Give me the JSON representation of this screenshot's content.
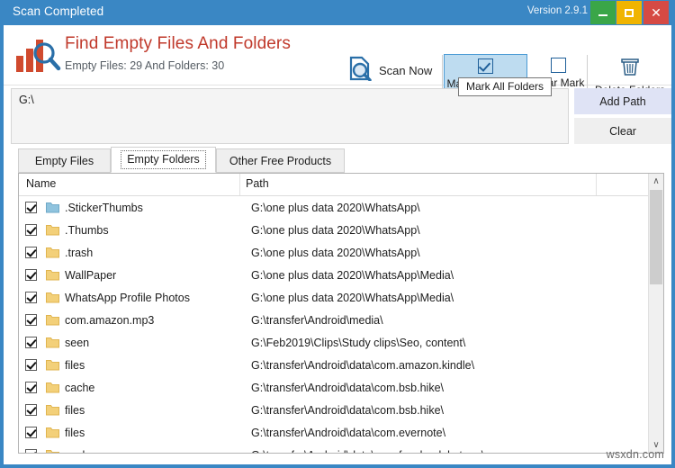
{
  "window": {
    "title": "Scan Completed",
    "version": "Version 2.9.1",
    "minimize_label": "Minimize",
    "maximize_label": "Maximize",
    "close_label": "Close",
    "frame_color": "#3a87c4"
  },
  "header": {
    "app_title": "Find Empty Files And Folders",
    "subtitle": "Empty Files: 29 And Folders: 30",
    "title_color": "#c0392b",
    "logo_bar_color": "#d04a2e",
    "logo_lens_color": "#2a6fa8"
  },
  "toolbar": {
    "scan_label": "Scan Now",
    "mark_all_label": "Mark All Folders",
    "clear_mark_label": "Clear Mark",
    "delete_label": "Delete Folders",
    "active_button_bg": "#bedcf0",
    "active_button_border": "#4a9ad4"
  },
  "tooltip": {
    "text": "Mark All Folders"
  },
  "path_panel": {
    "value": "G:\\",
    "placeholder": "",
    "add_path_label": "Add Path",
    "clear_label": "Clear",
    "add_path_bg": "#dfe3f5"
  },
  "tabs": [
    {
      "label": "Empty Files",
      "active": false
    },
    {
      "label": "Empty Folders",
      "active": true
    },
    {
      "label": "Other Free Products",
      "active": false
    }
  ],
  "list": {
    "columns": [
      "Name",
      "Path"
    ],
    "rows": [
      {
        "checked": true,
        "name": ".StickerThumbs",
        "path": "G:\\one plus data 2020\\WhatsApp\\",
        "icon": "folder-blue-icon"
      },
      {
        "checked": true,
        "name": ".Thumbs",
        "path": "G:\\one plus data 2020\\WhatsApp\\",
        "icon": "folder-icon"
      },
      {
        "checked": true,
        "name": ".trash",
        "path": "G:\\one plus data 2020\\WhatsApp\\",
        "icon": "folder-icon"
      },
      {
        "checked": true,
        "name": "WallPaper",
        "path": "G:\\one plus data 2020\\WhatsApp\\Media\\",
        "icon": "folder-icon"
      },
      {
        "checked": true,
        "name": "WhatsApp Profile Photos",
        "path": "G:\\one plus data 2020\\WhatsApp\\Media\\",
        "icon": "folder-icon"
      },
      {
        "checked": true,
        "name": "com.amazon.mp3",
        "path": "G:\\transfer\\Android\\media\\",
        "icon": "folder-icon"
      },
      {
        "checked": true,
        "name": "seen",
        "path": "G:\\Feb2019\\Clips\\Study clips\\Seo, content\\",
        "icon": "folder-icon"
      },
      {
        "checked": true,
        "name": "files",
        "path": "G:\\transfer\\Android\\data\\com.amazon.kindle\\",
        "icon": "folder-icon"
      },
      {
        "checked": true,
        "name": "cache",
        "path": "G:\\transfer\\Android\\data\\com.bsb.hike\\",
        "icon": "folder-icon"
      },
      {
        "checked": true,
        "name": "files",
        "path": "G:\\transfer\\Android\\data\\com.bsb.hike\\",
        "icon": "folder-icon"
      },
      {
        "checked": true,
        "name": "files",
        "path": "G:\\transfer\\Android\\data\\com.evernote\\",
        "icon": "folder-icon"
      },
      {
        "checked": true,
        "name": "cache",
        "path": "G:\\transfer\\Android\\data\\com.facebook.katana\\",
        "icon": "folder-icon"
      }
    ]
  },
  "scrollbar": {
    "up_glyph": "∧",
    "down_glyph": "∨"
  },
  "watermark": "wsxdn.com"
}
